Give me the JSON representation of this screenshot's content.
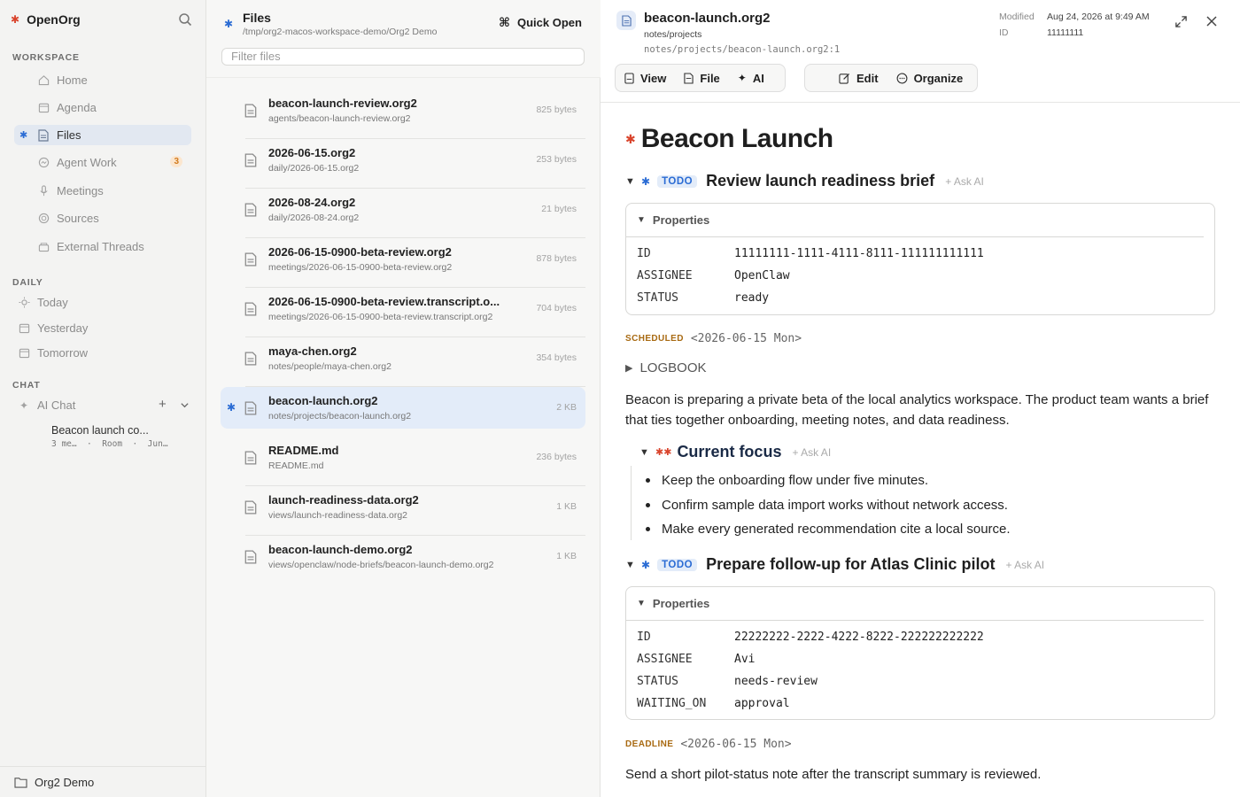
{
  "sidebar": {
    "app_name": "OpenOrg",
    "sections": {
      "workspace": "WORKSPACE",
      "daily": "DAILY",
      "chat": "CHAT"
    },
    "workspace_items": [
      {
        "label": "Home",
        "icon": "home-icon"
      },
      {
        "label": "Agenda",
        "icon": "calendar-icon"
      },
      {
        "label": "Files",
        "icon": "file-icon"
      },
      {
        "label": "Agent Work",
        "icon": "agent-icon",
        "badge": "3"
      },
      {
        "label": "Meetings",
        "icon": "mic-icon"
      },
      {
        "label": "Sources",
        "icon": "sources-icon"
      },
      {
        "label": "External Threads",
        "icon": "threads-icon"
      }
    ],
    "daily_items": [
      {
        "label": "Today",
        "icon": "sun-icon"
      },
      {
        "label": "Yesterday",
        "icon": "calendar-icon"
      },
      {
        "label": "Tomorrow",
        "icon": "calendar-icon"
      }
    ],
    "chat": {
      "label": "AI Chat",
      "thread_title": "Beacon launch co...",
      "thread_meta": "3 me…  ·  Room  ·  Jun…"
    },
    "footer": "Org2 Demo"
  },
  "files_panel": {
    "title": "Files",
    "path": "/tmp/org2-macos-workspace-demo/Org2 Demo",
    "quick_open": "Quick Open",
    "filter_placeholder": "Filter files",
    "files": [
      {
        "name": "beacon-launch-review.org2",
        "path": "agents/beacon-launch-review.org2",
        "size": "825 bytes"
      },
      {
        "name": "2026-06-15.org2",
        "path": "daily/2026-06-15.org2",
        "size": "253 bytes"
      },
      {
        "name": "2026-08-24.org2",
        "path": "daily/2026-08-24.org2",
        "size": "21 bytes"
      },
      {
        "name": "2026-06-15-0900-beta-review.org2",
        "path": "meetings/2026-06-15-0900-beta-review.org2",
        "size": "878 bytes"
      },
      {
        "name": "2026-06-15-0900-beta-review.transcript.o...",
        "path": "meetings/2026-06-15-0900-beta-review.transcript.org2",
        "size": "704 bytes"
      },
      {
        "name": "maya-chen.org2",
        "path": "notes/people/maya-chen.org2",
        "size": "354 bytes"
      },
      {
        "name": "beacon-launch.org2",
        "path": "notes/projects/beacon-launch.org2",
        "size": "2 KB",
        "selected": true
      },
      {
        "name": "README.md",
        "path": "README.md",
        "size": "236 bytes"
      },
      {
        "name": "launch-readiness-data.org2",
        "path": "views/launch-readiness-data.org2",
        "size": "1 KB"
      },
      {
        "name": "beacon-launch-demo.org2",
        "path": "views/openclaw/node-briefs/beacon-launch-demo.org2",
        "size": "1 KB"
      }
    ]
  },
  "document": {
    "file_name": "beacon-launch.org2",
    "dir": "notes/projects",
    "location": "notes/projects/beacon-launch.org2:1",
    "meta": {
      "modified_label": "Modified",
      "modified_value": "Aug 24, 2026 at 9:49 AM",
      "id_label": "ID",
      "id_value": "11111111"
    },
    "toolbar": {
      "view": "View",
      "file": "File",
      "ai": "AI",
      "edit": "Edit",
      "organize": "Organize"
    },
    "title": "Beacon Launch",
    "todo_label": "TODO",
    "ask_ai": "+ Ask AI",
    "properties_label": "Properties",
    "heading1": {
      "text": "Review launch readiness brief",
      "props": [
        {
          "k": "ID",
          "v": "11111111-1111-4111-8111-111111111111"
        },
        {
          "k": "ASSIGNEE",
          "v": "OpenClaw"
        },
        {
          "k": "STATUS",
          "v": "ready"
        }
      ],
      "keyword": "SCHEDULED",
      "date": "<2026-06-15 Mon>"
    },
    "logbook": "LOGBOOK",
    "paragraph": "Beacon is preparing a private beta of the local analytics workspace. The product team wants a brief that ties together onboarding, meeting notes, and data readiness.",
    "subheading": "Current focus",
    "bullets": [
      "Keep the onboarding flow under five minutes.",
      "Confirm sample data import works without network access.",
      "Make every generated recommendation cite a local source."
    ],
    "heading2": {
      "text": "Prepare follow-up for Atlas Clinic pilot",
      "props": [
        {
          "k": "ID",
          "v": "22222222-2222-4222-8222-222222222222"
        },
        {
          "k": "ASSIGNEE",
          "v": "Avi"
        },
        {
          "k": "STATUS",
          "v": "needs-review"
        },
        {
          "k": "WAITING_ON",
          "v": "approval"
        }
      ],
      "keyword": "DEADLINE",
      "date": "<2026-06-15 Mon>"
    },
    "closing": "Send a short pilot-status note after the transcript summary is reviewed."
  },
  "colors": {
    "accent": "#2b6cd4",
    "brand": "#d9442c",
    "selected_bg": "#e3ecf9"
  }
}
